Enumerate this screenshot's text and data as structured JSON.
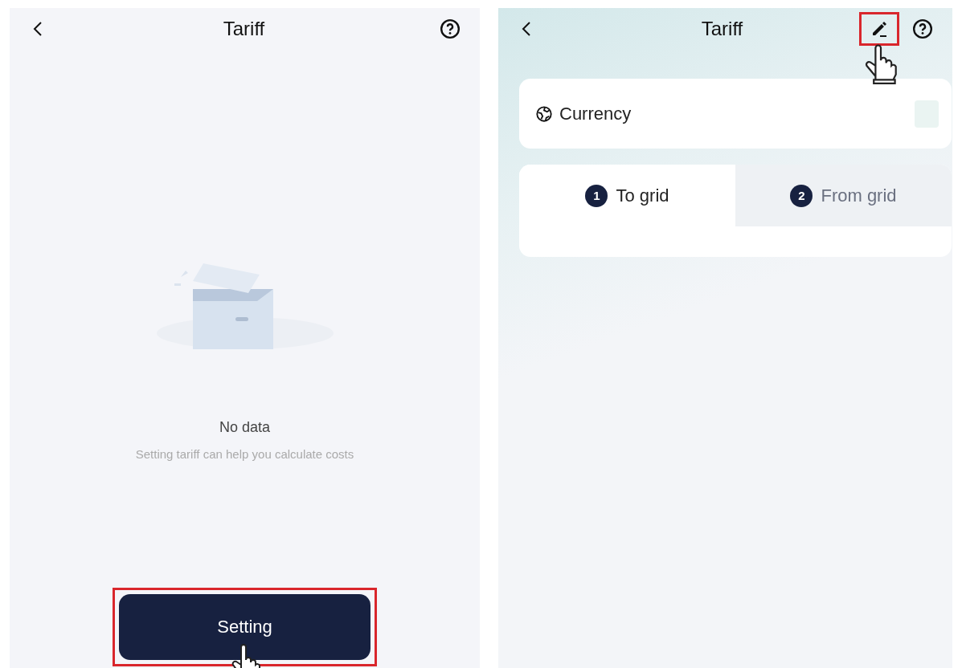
{
  "left_screen": {
    "title": "Tariff",
    "empty_state": {
      "heading": "No data",
      "message": "Setting tariff can help you calculate costs"
    },
    "button": {
      "label": "Setting",
      "highlighted": true
    }
  },
  "right_screen": {
    "title": "Tariff",
    "edit_highlighted": true,
    "currency": {
      "label": "Currency"
    },
    "tabs": [
      {
        "number": "1",
        "label": "To grid",
        "selected": true
      },
      {
        "number": "2",
        "label": "From grid",
        "selected": false
      }
    ]
  }
}
